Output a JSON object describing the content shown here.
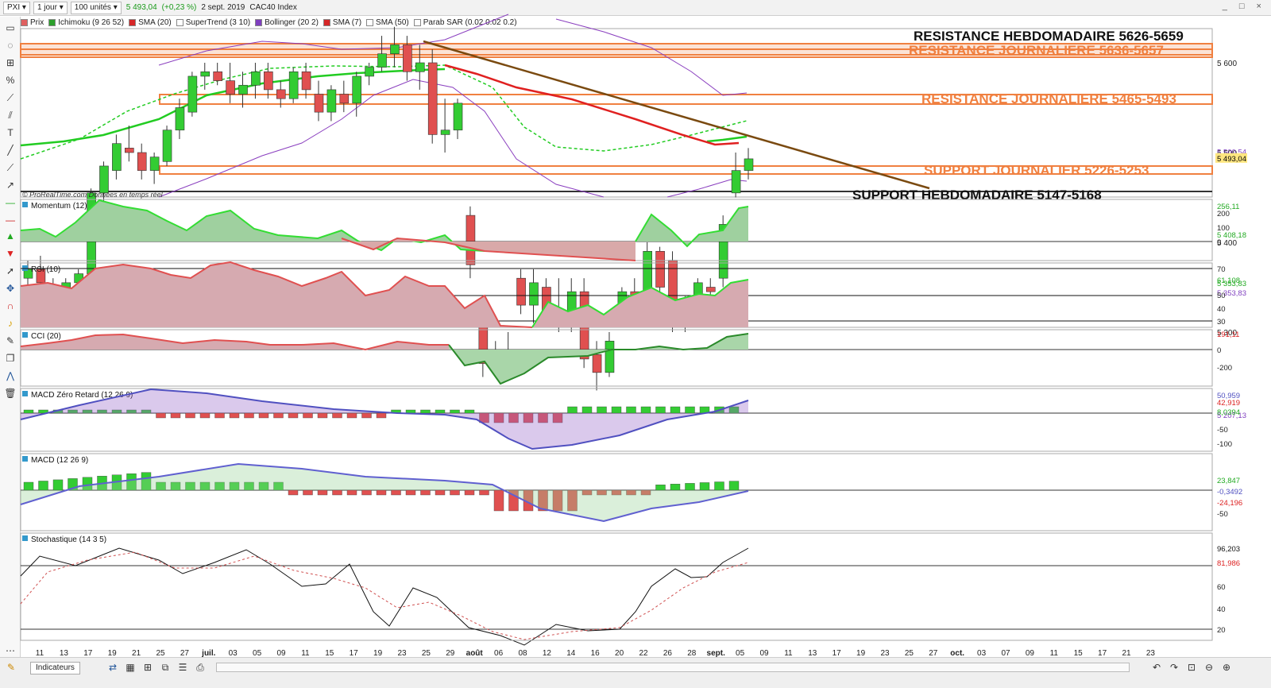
{
  "toolbar": {
    "symbol": "PXI",
    "period": "1 jour",
    "units": "100 unités",
    "quote": "5 493,04",
    "change": "(+0,23 %)",
    "date": "2 sept. 2019",
    "instrument": "CAC40 Index",
    "window_controls": "_ □ ×"
  },
  "legend": [
    {
      "label": "Prix",
      "color": "#e06060"
    },
    {
      "label": "Ichimoku (9 26 52)",
      "color": "#2ca02c"
    },
    {
      "label": "SMA (20)",
      "color": "#d62728"
    },
    {
      "label": "SuperTrend (3 10)",
      "color": "#ffffff"
    },
    {
      "label": "Bollinger (20 2)",
      "color": "#7f3fbf"
    },
    {
      "label": "SMA (7)",
      "color": "#d62728"
    },
    {
      "label": "SMA (50)",
      "color": "#ffffff"
    },
    {
      "label": "Parab SAR (0.02 0.02 0.2)",
      "color": "#ffffff"
    }
  ],
  "attribution": "© ProRealTime.com  Données en temps réel",
  "annotations": {
    "res_hebdo": "RESISTANCE HEBDOMADAIRE 5626-5659",
    "res_journ_1": "RESISTANCE JOURNALIERE 5636-5657",
    "res_journ_2": "RESISTANCE JOURNALIERE 5465-5493",
    "sup_journ": "SUPPORT JOURNALIER 5226-5253",
    "sup_hebdo": "SUPPORT HEBDOMADAIRE 5147-5168"
  },
  "panels": {
    "momentum": "Momentum (12)",
    "rsi": "RSI (10)",
    "cci": "CCI (20)",
    "macd_zr": "MACD Zéro Retard (12 26 9)",
    "macd": "MACD (12 26 9)",
    "stoch": "Stochastique (14 3 5)"
  },
  "bottom": {
    "indicators_button": "Indicateurs"
  },
  "colors": {
    "up": "#33cc33",
    "down": "#e05050",
    "sma20": "#e02020",
    "ichimoku": "#22cc22",
    "bollinger": "#8a3fbf",
    "trend": "#7a4a10",
    "zone": "#f08040"
  },
  "chart_data": {
    "type": "candlestick",
    "price_axis": {
      "ticks": [
        5700,
        5600,
        5500,
        5400,
        5300
      ],
      "labels": [
        "5 700",
        "5 600",
        "5 500",
        "5 400",
        "5 300"
      ]
    },
    "price_tags": [
      {
        "label": "5 500,54",
        "value": 5500.54,
        "color": "#7f3fbf"
      },
      {
        "label": "5 493,04",
        "value": 5493.04,
        "color": "#000000",
        "bg": "#ffe680"
      },
      {
        "label": "5 408,18",
        "value": 5408.18,
        "color": "#22aa22"
      },
      {
        "label": "5 353,83",
        "value": 5353.83,
        "color": "#22aa22"
      },
      {
        "label": "5 353,83",
        "value": 5353.83,
        "color": "#7f3fbf"
      },
      {
        "label": "5 207,13",
        "value": 5207.13,
        "color": "#7f3fbf"
      }
    ],
    "x_labels": [
      "11",
      "13",
      "17",
      "19",
      "21",
      "25",
      "27",
      "juil.",
      "03",
      "05",
      "09",
      "11",
      "15",
      "17",
      "19",
      "23",
      "25",
      "29",
      "août",
      "06",
      "08",
      "12",
      "14",
      "16",
      "20",
      "22",
      "26",
      "28",
      "sept.",
      "05",
      "09",
      "11",
      "13",
      "17",
      "19",
      "23",
      "25",
      "27",
      "oct.",
      "03",
      "07",
      "09",
      "11",
      "15",
      "17",
      "21",
      "23"
    ],
    "candles": [
      [
        5360,
        5380,
        5340,
        5370
      ],
      [
        5370,
        5385,
        5350,
        5355
      ],
      [
        5350,
        5360,
        5335,
        5340
      ],
      [
        5340,
        5360,
        5320,
        5355
      ],
      [
        5355,
        5370,
        5335,
        5365
      ],
      [
        5365,
        5460,
        5360,
        5455
      ],
      [
        5455,
        5490,
        5445,
        5485
      ],
      [
        5480,
        5520,
        5470,
        5510
      ],
      [
        5505,
        5530,
        5490,
        5500
      ],
      [
        5500,
        5510,
        5470,
        5480
      ],
      [
        5480,
        5500,
        5465,
        5495
      ],
      [
        5490,
        5530,
        5485,
        5525
      ],
      [
        5525,
        5560,
        5515,
        5550
      ],
      [
        5545,
        5590,
        5540,
        5585
      ],
      [
        5585,
        5600,
        5570,
        5590
      ],
      [
        5590,
        5600,
        5575,
        5580
      ],
      [
        5580,
        5600,
        5555,
        5565
      ],
      [
        5565,
        5590,
        5550,
        5575
      ],
      [
        5575,
        5600,
        5560,
        5590
      ],
      [
        5590,
        5600,
        5560,
        5570
      ],
      [
        5570,
        5580,
        5550,
        5560
      ],
      [
        5560,
        5595,
        5555,
        5590
      ],
      [
        5590,
        5600,
        5560,
        5570
      ],
      [
        5565,
        5580,
        5535,
        5545
      ],
      [
        5545,
        5575,
        5535,
        5570
      ],
      [
        5565,
        5580,
        5545,
        5555
      ],
      [
        5555,
        5590,
        5540,
        5585
      ],
      [
        5585,
        5600,
        5575,
        5595
      ],
      [
        5595,
        5630,
        5590,
        5610
      ],
      [
        5610,
        5640,
        5595,
        5620
      ],
      [
        5620,
        5630,
        5580,
        5590
      ],
      [
        5590,
        5620,
        5570,
        5600
      ],
      [
        5600,
        5615,
        5510,
        5520
      ],
      [
        5520,
        5560,
        5500,
        5525
      ],
      [
        5525,
        5560,
        5515,
        5555
      ],
      [
        5430,
        5440,
        5360,
        5375
      ],
      [
        5310,
        5320,
        5250,
        5265
      ],
      [
        5270,
        5290,
        5250,
        5260
      ],
      [
        5260,
        5300,
        5250,
        5270
      ],
      [
        5360,
        5370,
        5320,
        5330
      ],
      [
        5330,
        5370,
        5310,
        5355
      ],
      [
        5350,
        5360,
        5310,
        5320
      ],
      [
        5325,
        5360,
        5300,
        5310
      ],
      [
        5320,
        5360,
        5300,
        5345
      ],
      [
        5345,
        5360,
        5260,
        5270
      ],
      [
        5275,
        5290,
        5235,
        5255
      ],
      [
        5255,
        5300,
        5250,
        5290
      ],
      [
        5320,
        5350,
        5310,
        5345
      ],
      [
        5345,
        5360,
        5320,
        5340
      ],
      [
        5340,
        5400,
        5330,
        5390
      ],
      [
        5390,
        5395,
        5340,
        5350
      ],
      [
        5380,
        5390,
        5300,
        5320
      ],
      [
        5330,
        5340,
        5300,
        5320
      ],
      [
        5320,
        5360,
        5310,
        5355
      ],
      [
        5350,
        5360,
        5320,
        5345
      ],
      [
        5360,
        5430,
        5350,
        5420
      ],
      [
        5455,
        5500,
        5450,
        5480
      ],
      [
        5480,
        5505,
        5470,
        5493
      ]
    ],
    "momentum_ticks": [
      "256,11",
      "200",
      "100",
      "0"
    ],
    "rsi_ticks": [
      "70",
      "61,108",
      "50",
      "40",
      "30"
    ],
    "cci_ticks": [
      "191,11",
      "0",
      "-200"
    ],
    "macdzr_ticks": [
      "50,959",
      "42,919",
      "8,0394",
      "-50",
      "-100"
    ],
    "macd_ticks": [
      "23,847",
      "-0,3492",
      "-24,196",
      "-50"
    ],
    "stoch_ticks": [
      "96,203",
      "81,986",
      "60",
      "40",
      "20"
    ]
  }
}
